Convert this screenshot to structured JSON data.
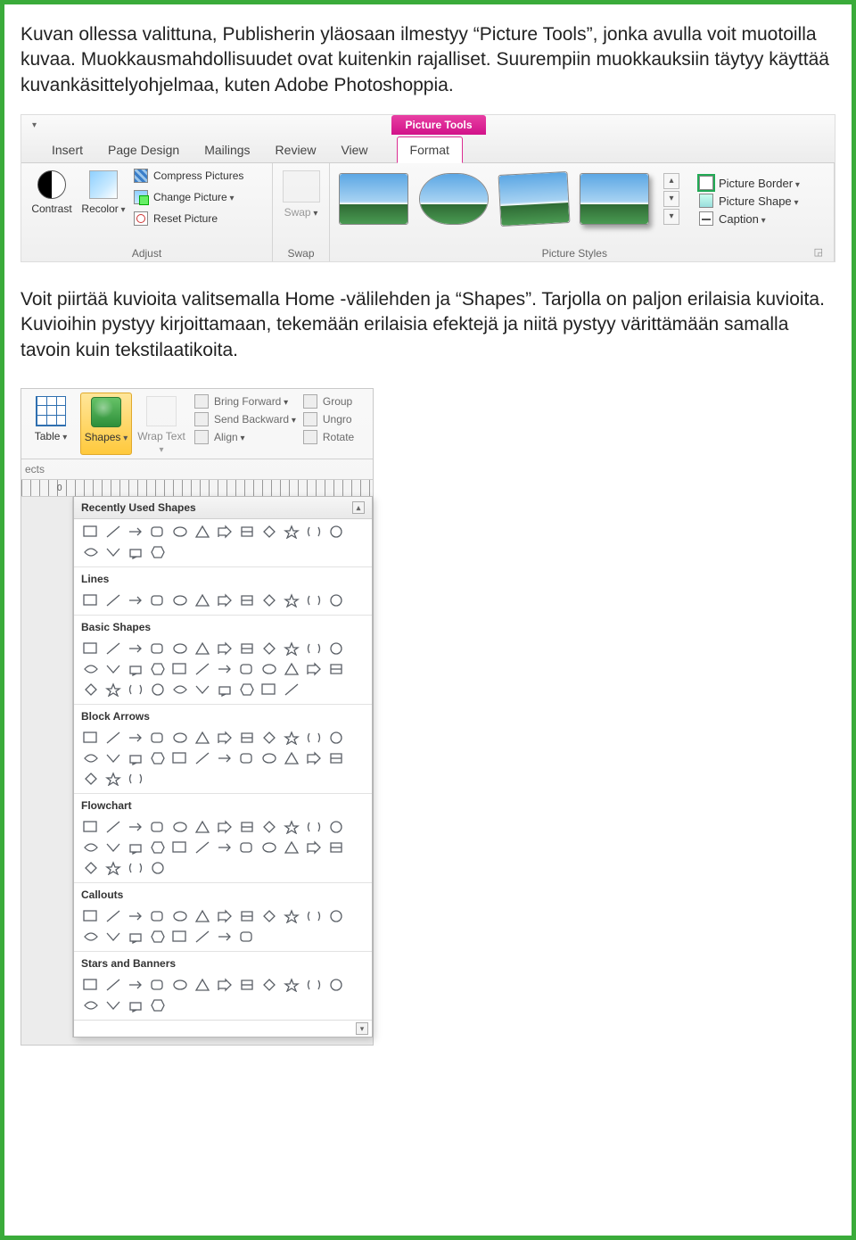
{
  "intro_text": "Kuvan ollessa valittuna, Publisherin yläosaan ilmestyy “Picture Tools”, jonka avulla voit muotoilla kuvaa. Muokkausmahdollisuudet ovat kuitenkin rajalliset. Suurempiin muokkauksiin täytyy käyttää kuvankäsittelyohjelmaa, kuten Adobe Photoshoppia.",
  "mid_text": "Voit piirtää kuvioita valitsemalla Home -välilehden ja “Shapes”. Tarjolla on paljon erilaisia kuvioita. Kuvioihin pystyy kirjoittamaan, tekemään erilaisia efektejä ja niitä pystyy värittämään samalla tavoin kuin tekstilaatikoita.",
  "picture_tools": {
    "contextual_label": "Picture Tools",
    "tabs": {
      "insert": "Insert",
      "page_design": "Page Design",
      "mailings": "Mailings",
      "review": "Review",
      "view": "View",
      "format": "Format"
    },
    "adjust": {
      "contrast": "Contrast",
      "recolor": "Recolor",
      "compress": "Compress Pictures",
      "change": "Change Picture",
      "reset": "Reset Picture",
      "group_title": "Adjust"
    },
    "swap": {
      "label": "Swap",
      "group_title": "Swap"
    },
    "styles": {
      "group_title": "Picture Styles"
    },
    "border_group": {
      "border": "Picture Border",
      "shape": "Picture Shape",
      "caption": "Caption"
    }
  },
  "shapes_ribbon": {
    "objects_label": "ects",
    "table": "Table",
    "shapes": "Shapes",
    "wrap": "Wrap Text",
    "bring_forward": "Bring Forward",
    "send_backward": "Send Backward",
    "align": "Align",
    "group": "Group",
    "ungroup": "Ungro",
    "rotate": "Rotate",
    "ruler_zero": "0"
  },
  "shapes_panel": {
    "header": "Recently Used Shapes",
    "categories": {
      "lines": "Lines",
      "basic": "Basic Shapes",
      "block": "Block Arrows",
      "flow": "Flowchart",
      "callouts": "Callouts",
      "stars": "Stars and Banners"
    },
    "counts": {
      "recent": 16,
      "lines": 12,
      "basic": 34,
      "block": 27,
      "flow": 28,
      "callouts": 20,
      "stars": 16
    }
  }
}
